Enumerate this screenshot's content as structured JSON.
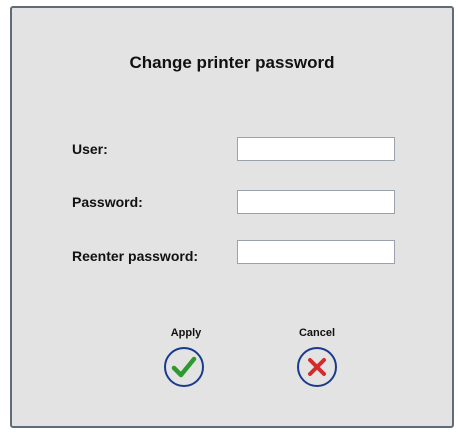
{
  "dialog": {
    "title": "Change printer password"
  },
  "form": {
    "user_label": "User:",
    "user_value": "",
    "password_label": "Password:",
    "password_value": "",
    "reenter_label": "Reenter password:",
    "reenter_value": ""
  },
  "buttons": {
    "apply_label": "Apply",
    "apply_icon": "check-icon",
    "cancel_label": "Cancel",
    "cancel_icon": "x-icon"
  },
  "colors": {
    "dialog_bg": "#e3e3e3",
    "button_ring": "#1a3a8c",
    "apply_check": "#2e9a2e",
    "cancel_x": "#d42a2a"
  }
}
